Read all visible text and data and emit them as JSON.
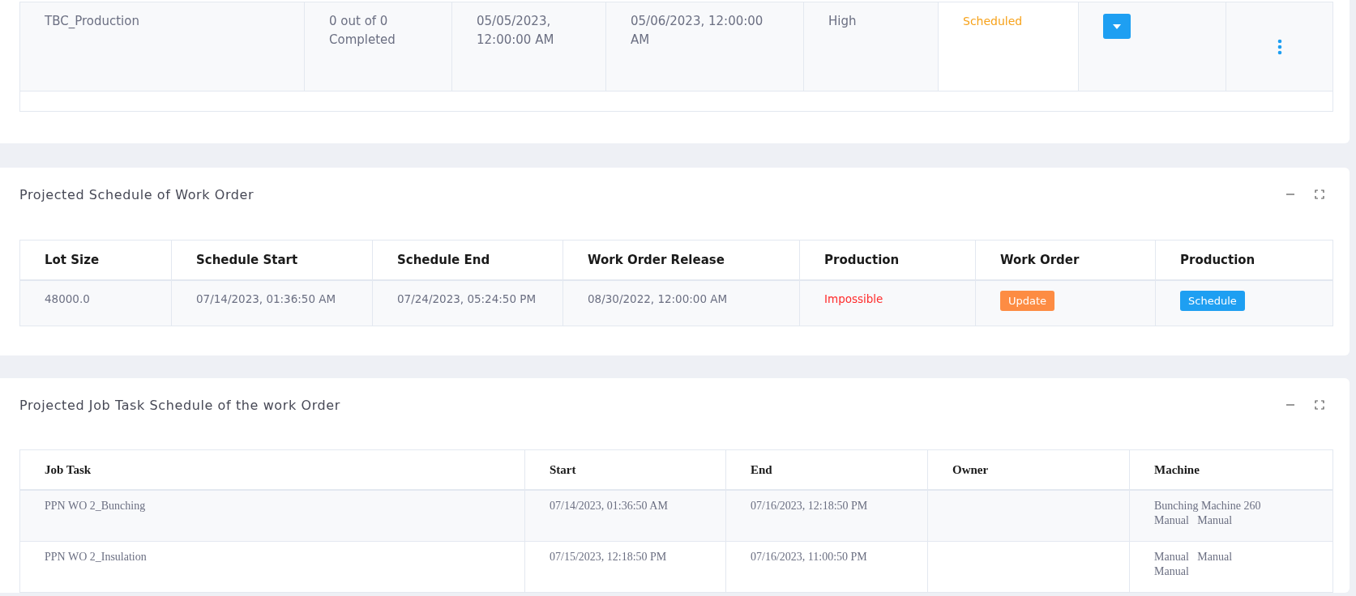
{
  "work_orders": {
    "rows": [
      {
        "name": "TBC_Production",
        "progress": "0 out of 0 Completed",
        "start": "05/05/2023, 12:00:00 AM",
        "end": "05/06/2023, 12:00:00 AM",
        "priority": "High",
        "status": "Scheduled"
      }
    ]
  },
  "projected_schedule": {
    "title": "Projected Schedule of Work Order",
    "columns": [
      "Lot Size",
      "Schedule Start",
      "Schedule End",
      "Work Order Release",
      "Production",
      "Work Order",
      "Production"
    ],
    "rows": [
      {
        "lot_size": "48000.0",
        "schedule_start": "07/14/2023, 01:36:50 AM",
        "schedule_end": "07/24/2023, 05:24:50 PM",
        "release": "08/30/2022, 12:00:00 AM",
        "production": "Impossible",
        "work_order_button": "Update",
        "production_button": "Schedule"
      }
    ]
  },
  "job_task_schedule": {
    "title": "Projected Job Task Schedule of the work Order",
    "columns": [
      "Job Task",
      "Start",
      "End",
      "Owner",
      "Machine"
    ],
    "rows": [
      {
        "job_task": "PPN WO 2_Bunching",
        "start": "07/14/2023, 01:36:50 AM",
        "end": "07/16/2023, 12:18:50 PM",
        "machine": [
          "Bunching Machine 260",
          "Manual   Manual"
        ]
      },
      {
        "job_task": "PPN WO 2_Insulation",
        "start": "07/15/2023, 12:18:50 PM",
        "end": "07/16/2023, 11:00:50 PM",
        "machine": [
          "Manual   Manual",
          "Manual"
        ]
      }
    ]
  }
}
